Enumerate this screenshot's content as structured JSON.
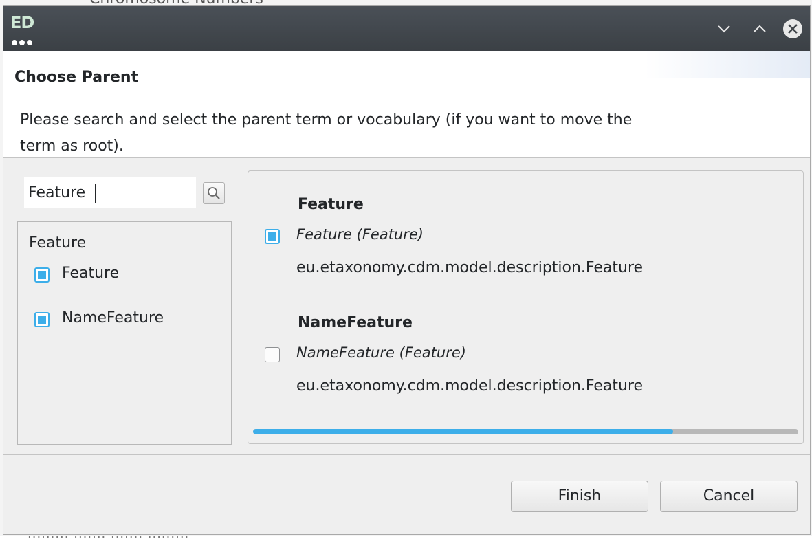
{
  "background": {
    "top_text": "Chromosome Numbers",
    "bottom_text": "......... ....... ....... ........."
  },
  "titlebar": {
    "logo_text": "ED",
    "buttons": [
      "minimize",
      "maximize",
      "close"
    ]
  },
  "header": {
    "title": "Choose Parent",
    "description": "Please search and select the parent term or vocabulary (if you want to move the term as root)."
  },
  "search": {
    "value": "Feature",
    "button_icon": "magnifier-icon"
  },
  "filter_list": {
    "title": "Feature",
    "items": [
      {
        "label": "Feature",
        "checked": true
      },
      {
        "label": "NameFeature",
        "checked": true
      }
    ]
  },
  "results": {
    "items": [
      {
        "title": "Feature",
        "subtitle": "Feature (Feature)",
        "class_name": "eu.etaxonomy.cdm.model.description.Feature",
        "checked": true
      },
      {
        "title": "NameFeature",
        "subtitle": "NameFeature (Feature)",
        "class_name": "eu.etaxonomy.cdm.model.description.Feature",
        "checked": false
      }
    ],
    "progress_percent": 77
  },
  "footer": {
    "finish_label": "Finish",
    "cancel_label": "Cancel"
  },
  "colors": {
    "accent": "#3daee9",
    "titlebar": "#41464b",
    "window": "#efefef"
  }
}
